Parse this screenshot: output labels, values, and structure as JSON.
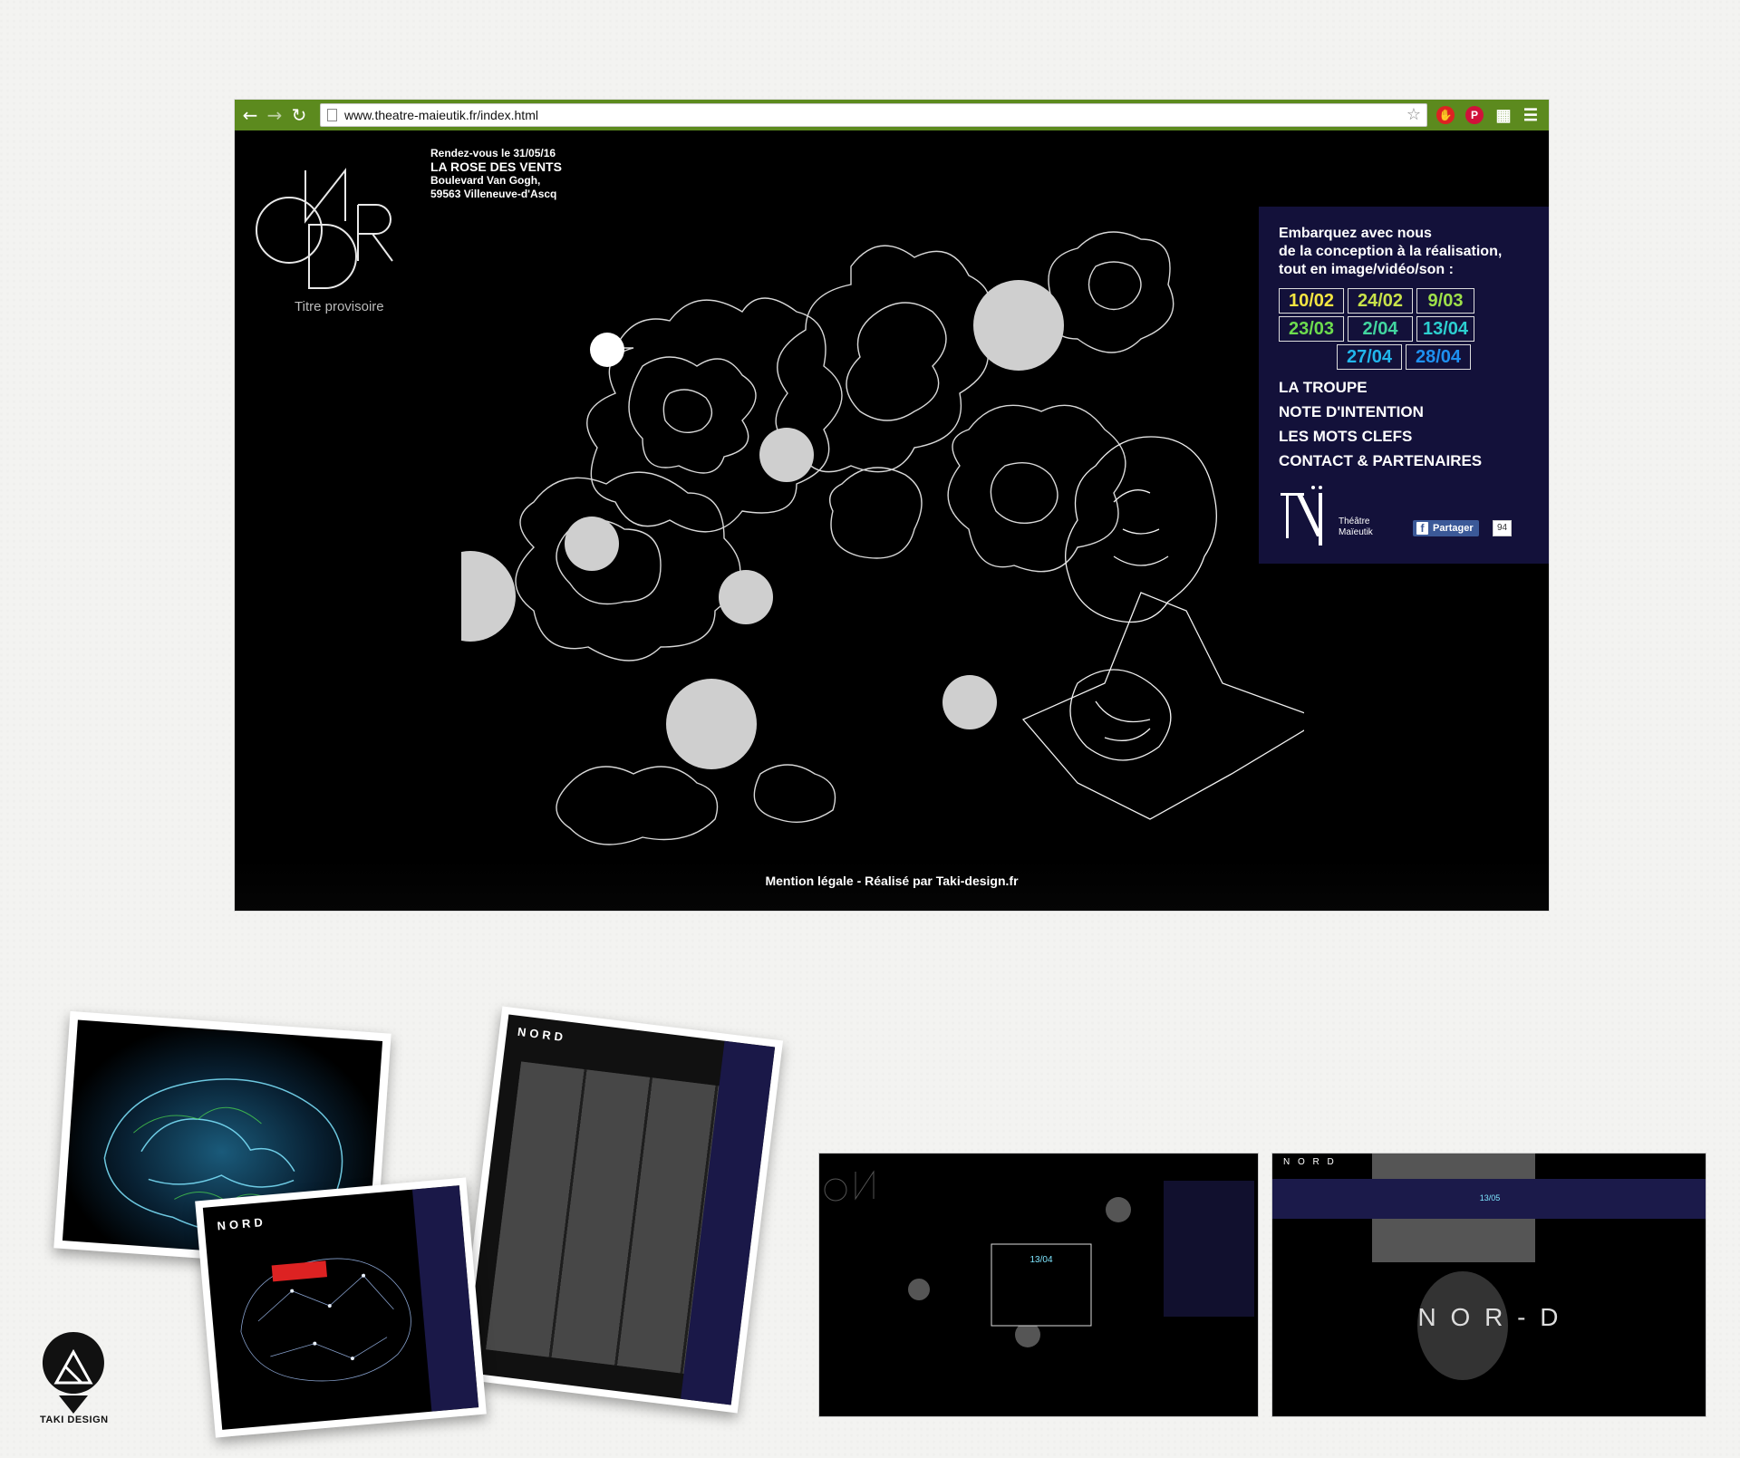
{
  "browser": {
    "url": "www.theatre-maieutik.fr/index.html",
    "nav_icons": [
      "back-arrow-icon",
      "forward-arrow-icon",
      "reload-icon"
    ],
    "toolbar_icons": [
      "bookmark-star-icon",
      "adblock-icon",
      "pinterest-icon",
      "reader-icon",
      "menu-icon"
    ]
  },
  "site": {
    "logo_subtitle": "Titre provisoire",
    "event": {
      "date_line": "Rendez-vous le 31/05/16",
      "venue": "LA ROSE DES VENTS",
      "address1": "Boulevard Van Gogh,",
      "address2": "59563 Villeneuve-d'Ascq"
    },
    "panel": {
      "intro_1": "Embarquez avec nous",
      "intro_2": "de la conception à la réalisation,",
      "intro_3": "tout en image/vidéo/son :",
      "dates": [
        {
          "label": "10/02",
          "color": "#f4e542"
        },
        {
          "label": "24/02",
          "color": "#c8e24a"
        },
        {
          "label": "9/03",
          "color": "#9ee04a"
        },
        {
          "label": "23/03",
          "color": "#6ddc4e"
        },
        {
          "label": "2/04",
          "color": "#42d6a0"
        },
        {
          "label": "13/04",
          "color": "#2ccfd0"
        },
        {
          "label": "27/04",
          "color": "#21b6ec"
        },
        {
          "label": "28/04",
          "color": "#1e90f0"
        }
      ],
      "menu": [
        "LA TROUPE",
        "NOTE D'INTENTION",
        "LES MOTS CLEFS",
        "CONTACT & PARTENAIRES"
      ],
      "theatre_name_1": "Théâtre",
      "theatre_name_2": "Maïeutik",
      "share_label": "Partager",
      "share_count": "94"
    },
    "footer": "Mention légale - Réalisé par Taki-design.fr"
  },
  "thumbnails": {
    "nord_title": "NORD",
    "nord_title_spaced": "N O R D",
    "nord_center_title": "N O R - D",
    "shot1_popup_date": "13/04",
    "shot2_date": "13/05",
    "brand": "TAKI DESIGN"
  }
}
